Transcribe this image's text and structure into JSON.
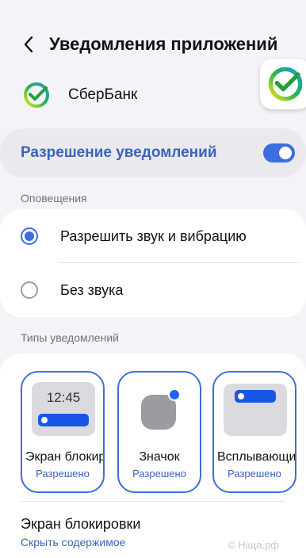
{
  "header": {
    "back_icon": "chevron-left-icon",
    "title": "Уведомления приложений"
  },
  "app": {
    "name": "СберБанк",
    "icon": "sberbank-logo-icon"
  },
  "permission": {
    "label": "Разрешение уведомлений",
    "enabled": true
  },
  "alerts": {
    "section_label": "Оповещения",
    "options": [
      {
        "label": "Разрешить звук и вибрацию",
        "selected": true
      },
      {
        "label": "Без звука",
        "selected": false
      }
    ]
  },
  "types": {
    "section_label": "Типы уведомлений",
    "tiles": [
      {
        "title": "Экран блокировки",
        "status": "Разрешено",
        "preview_time": "12:45"
      },
      {
        "title": "Значок",
        "status": "Разрешено"
      },
      {
        "title": "Всплывающие",
        "status": "Разрешено"
      }
    ]
  },
  "lock_screen": {
    "title": "Экран блокировки",
    "subtitle": "Скрыть содержимое"
  },
  "watermark": "© Ніща.рф",
  "colors": {
    "accent": "#3d6ee0",
    "accent_text": "#3b64b8",
    "background": "#f4f4f8"
  }
}
